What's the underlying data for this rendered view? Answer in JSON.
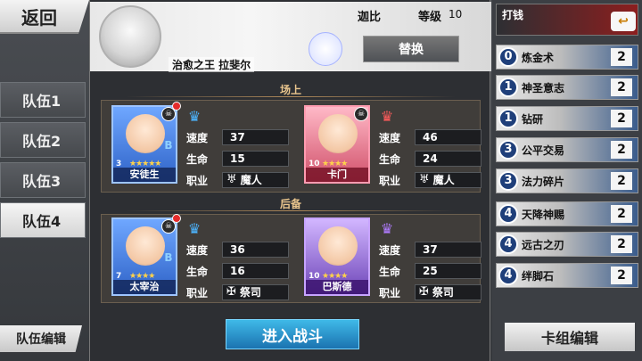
{
  "nav": {
    "back_label": "返回"
  },
  "teams": {
    "tabs": [
      {
        "label": "队伍1",
        "active": false
      },
      {
        "label": "队伍2",
        "active": false
      },
      {
        "label": "队伍3",
        "active": false
      },
      {
        "label": "队伍4",
        "active": true
      }
    ],
    "edit_label": "队伍编辑"
  },
  "header": {
    "hero_title": "治愈之王 拉斐尔",
    "player_name": "迦比",
    "level_label": "等级",
    "level_value": "10",
    "replace_label": "替换"
  },
  "sections": {
    "onfield": "场上",
    "reserve": "后备"
  },
  "stat_labels": {
    "speed": "速度",
    "hp": "生命",
    "job": "职业"
  },
  "characters": [
    {
      "name": "安徒生",
      "level": "3",
      "stars": "★★★★★",
      "speed": "37",
      "hp": "15",
      "job": "魔人",
      "job_icon": "demon-icon",
      "rarity": "B",
      "has_alert": true
    },
    {
      "name": "卡门",
      "level": "10",
      "stars": "★★★★",
      "speed": "46",
      "hp": "24",
      "job": "魔人",
      "job_icon": "demon-icon",
      "rarity": "",
      "has_alert": false
    },
    {
      "name": "太宰治",
      "level": "7",
      "stars": "★★★★",
      "speed": "36",
      "hp": "16",
      "job": "祭司",
      "job_icon": "cross-icon",
      "rarity": "B",
      "has_alert": true
    },
    {
      "name": "巴斯德",
      "level": "10",
      "stars": "★★★★",
      "speed": "37",
      "hp": "25",
      "job": "祭司",
      "job_icon": "cross-icon",
      "rarity": "",
      "has_alert": false
    }
  ],
  "fight_label": "进入战斗",
  "deck": {
    "title": "打钱",
    "cards": [
      {
        "cost": "0",
        "name": "炼金术",
        "count": "2"
      },
      {
        "cost": "1",
        "name": "神圣意志",
        "count": "2"
      },
      {
        "cost": "1",
        "name": "钻研",
        "count": "2"
      },
      {
        "cost": "3",
        "name": "公平交易",
        "count": "2"
      },
      {
        "cost": "3",
        "name": "法力碎片",
        "count": "2"
      },
      {
        "cost": "4",
        "name": "天降神赐",
        "count": "2"
      },
      {
        "cost": "4",
        "name": "远古之刃",
        "count": "2"
      },
      {
        "cost": "4",
        "name": "绊脚石",
        "count": "2"
      }
    ],
    "edit_label": "卡组编辑"
  }
}
